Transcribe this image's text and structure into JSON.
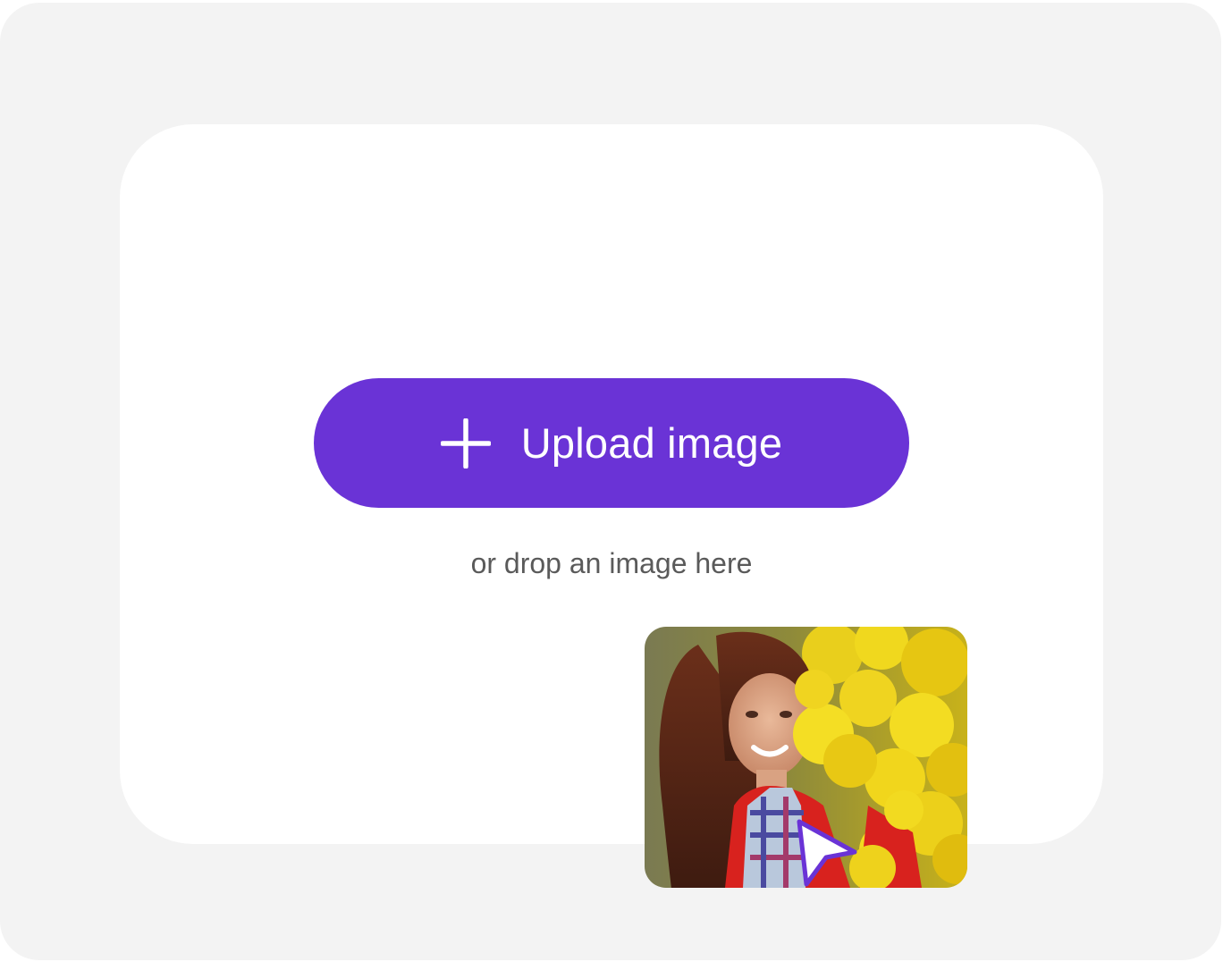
{
  "upload": {
    "button_label": "Upload image",
    "hint": "or drop an image here"
  },
  "icons": {
    "add": "plus-icon",
    "cursor": "arrow-cursor-icon"
  },
  "colors": {
    "accent": "#6a33d6",
    "outer_background": "#f3f3f3",
    "dropzone_background": "#ffffff",
    "hint_text": "#5a5a5a"
  }
}
